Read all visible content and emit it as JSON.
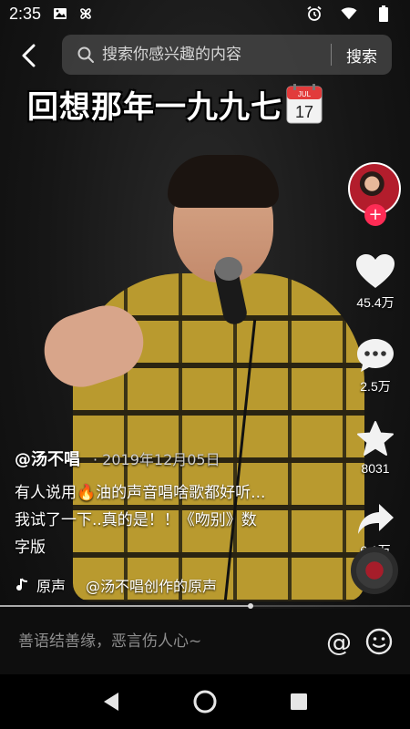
{
  "status_bar": {
    "time": "2:35",
    "icons": [
      "image-icon",
      "pinwheel-icon",
      "alarm-icon",
      "wifi-icon",
      "battery-icon"
    ]
  },
  "search": {
    "placeholder": "搜索你感兴趣的内容",
    "value": "",
    "button_label": "搜索"
  },
  "video": {
    "title_overlay": "回想那年一九九七",
    "calendar_month": "JUL",
    "calendar_day": "17"
  },
  "actions": {
    "likes": "45.4万",
    "comments": "2.5万",
    "favorites": "8031",
    "shares": "6.1万",
    "follow_symbol": "+"
  },
  "caption": {
    "author": "@汤不唱",
    "date": "· 2019年12月05日",
    "line1": "有人说用🔥油的声音唱啥歌都好听...",
    "line2": "我试了一下..真的是！！《吻别》数",
    "line3": "字版"
  },
  "music": {
    "sound_label": "原声",
    "source": "@汤不唱创作的原声"
  },
  "progress": {
    "fraction": 0.61
  },
  "comment": {
    "placeholder": "善语结善缘，恶言伤人心~",
    "at_symbol": "@"
  },
  "colors": {
    "accent": "#fe2c55",
    "background": "#000000",
    "text": "#ffffff"
  }
}
